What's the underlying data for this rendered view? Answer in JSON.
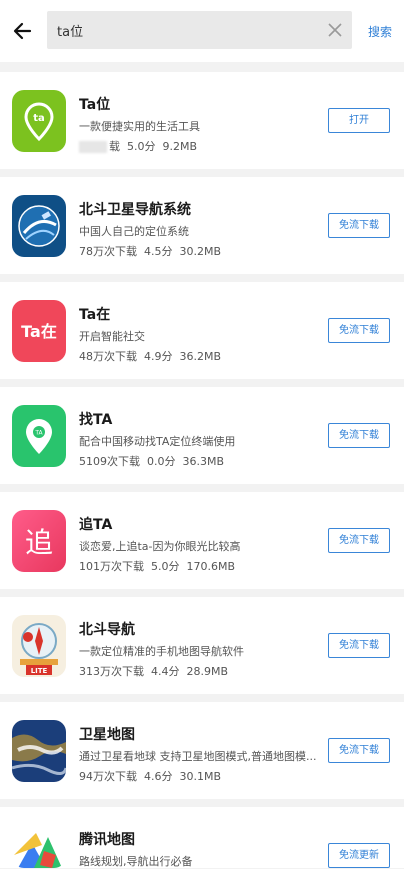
{
  "search": {
    "value": "ta位",
    "button_label": "搜索"
  },
  "apps": [
    {
      "name": "Ta位",
      "desc": "一款便捷实用的生活工具",
      "downloads": "载",
      "rating": "5.0分",
      "size": "9.2MB",
      "action": "打开",
      "icon": "ta-location-icon",
      "color": "#7cc21f"
    },
    {
      "name": "北斗卫星导航系统",
      "desc": "中国人自己的定位系统",
      "downloads": "78万次下载",
      "rating": "4.5分",
      "size": "30.2MB",
      "action": "免流下载",
      "icon": "beidou-satellite-icon",
      "color": "#0f4f86"
    },
    {
      "name": "Ta在",
      "desc": "开启智能社交",
      "downloads": "48万次下载",
      "rating": "4.9分",
      "size": "36.2MB",
      "action": "免流下载",
      "icon": "ta-zai-icon",
      "color": "#f0475a"
    },
    {
      "name": "找TA",
      "desc": "配合中国移动找TA定位终端使用",
      "downloads": "5109次下载",
      "rating": "0.0分",
      "size": "36.3MB",
      "action": "免流下载",
      "icon": "find-ta-icon",
      "color": "#29c46d"
    },
    {
      "name": "追TA",
      "desc": "谈恋爱,上追ta-因为你眼光比较高",
      "downloads": "101万次下载",
      "rating": "5.0分",
      "size": "170.6MB",
      "action": "免流下载",
      "icon": "zhui-ta-icon",
      "color": "#f2466f"
    },
    {
      "name": "北斗导航",
      "desc": "一款定位精准的手机地图导航软件",
      "downloads": "313万次下载",
      "rating": "4.4分",
      "size": "28.9MB",
      "action": "免流下载",
      "icon": "beidou-compass-icon",
      "color": "#d9342b"
    },
    {
      "name": "卫星地图",
      "desc": "通过卫星看地球 支持卫星地图模式,普通地图模...",
      "downloads": "94万次下载",
      "rating": "4.6分",
      "size": "30.1MB",
      "action": "免流下载",
      "icon": "satellite-earth-icon",
      "color": "#1b3e7a"
    },
    {
      "name": "腾讯地图",
      "desc": "路线规划,导航出行必备",
      "downloads": "",
      "rating": "",
      "size": "",
      "action": "免流更新",
      "icon": "tencent-map-icon",
      "color": "#3a7df0"
    }
  ]
}
